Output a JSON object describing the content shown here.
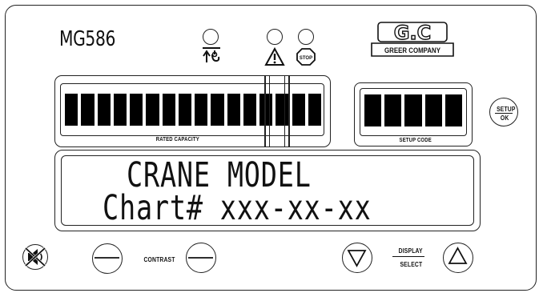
{
  "device": {
    "model": "MG586",
    "brand_logo_text": "G.C",
    "brand_name": "GREER COMPANY"
  },
  "indicators": [
    {
      "name": "anti-two-block",
      "icon": "anti-two-block-icon",
      "state": "off"
    },
    {
      "name": "warning",
      "icon": "warning-triangle-icon",
      "state": "off"
    },
    {
      "name": "stop",
      "icon": "stop-sign-icon",
      "label": "STOP",
      "state": "off"
    }
  ],
  "rated_capacity": {
    "label": "RATED CAPACITY",
    "segments_total": 16,
    "segments_lit": 16
  },
  "setup_code": {
    "label": "SETUP CODE",
    "segments_total": 5,
    "segments_lit": 5
  },
  "setup_ok_button": {
    "line1": "SETUP",
    "line2": "OK"
  },
  "lcd": {
    "line1": "CRANE MODEL",
    "line2": "Chart# xxx-xx-xx"
  },
  "bottom_controls": {
    "mute_icon": "mute-alarm-icon",
    "contrast_label": "CONTRAST",
    "display_select_line1": "DISPLAY",
    "display_select_line2": "SELECT"
  },
  "colors": {
    "ink": "#111111",
    "background": "#ffffff"
  }
}
